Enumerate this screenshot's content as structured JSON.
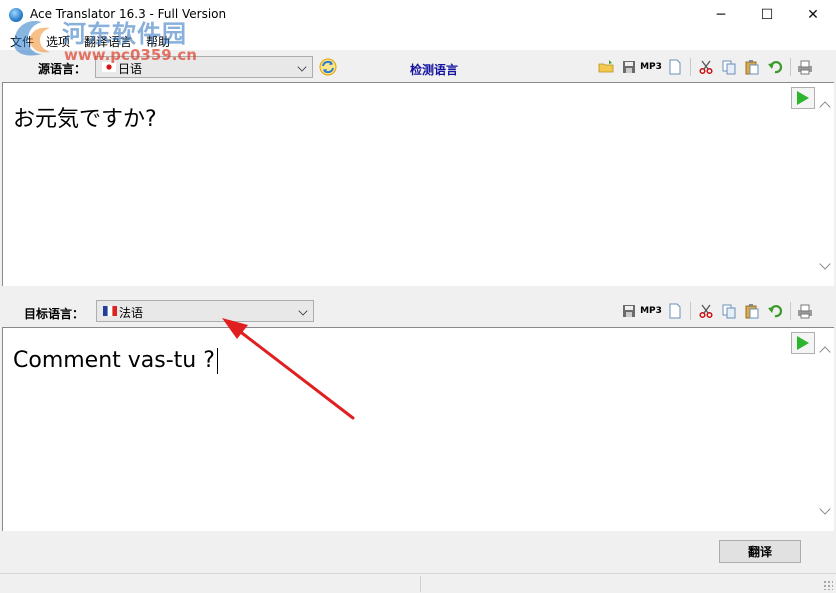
{
  "window": {
    "title": "Ace Translator 16.3 - Full Version",
    "minimize_label": "─",
    "maximize_label": "☐",
    "close_label": "✕"
  },
  "menu": [
    {
      "label": "文件"
    },
    {
      "label": "选项"
    },
    {
      "label": "翻译语言"
    },
    {
      "label": "帮助"
    }
  ],
  "watermark": {
    "line1": "河东软件园",
    "line2": "www.pc0359.cn"
  },
  "source": {
    "label": "源语言：",
    "language": "日语",
    "detect_label": "检测语言",
    "text": "お元気ですか?"
  },
  "target": {
    "label": "目标语言：",
    "language": "法语",
    "text": "Comment vas-tu ?"
  },
  "toolbar": {
    "mp3_label": "MP3"
  },
  "actions": {
    "translate_label": "翻译"
  },
  "colors": {
    "detect_link": "#1414a0",
    "play_green": "#2db52d",
    "annotation_arrow": "#e02020"
  }
}
